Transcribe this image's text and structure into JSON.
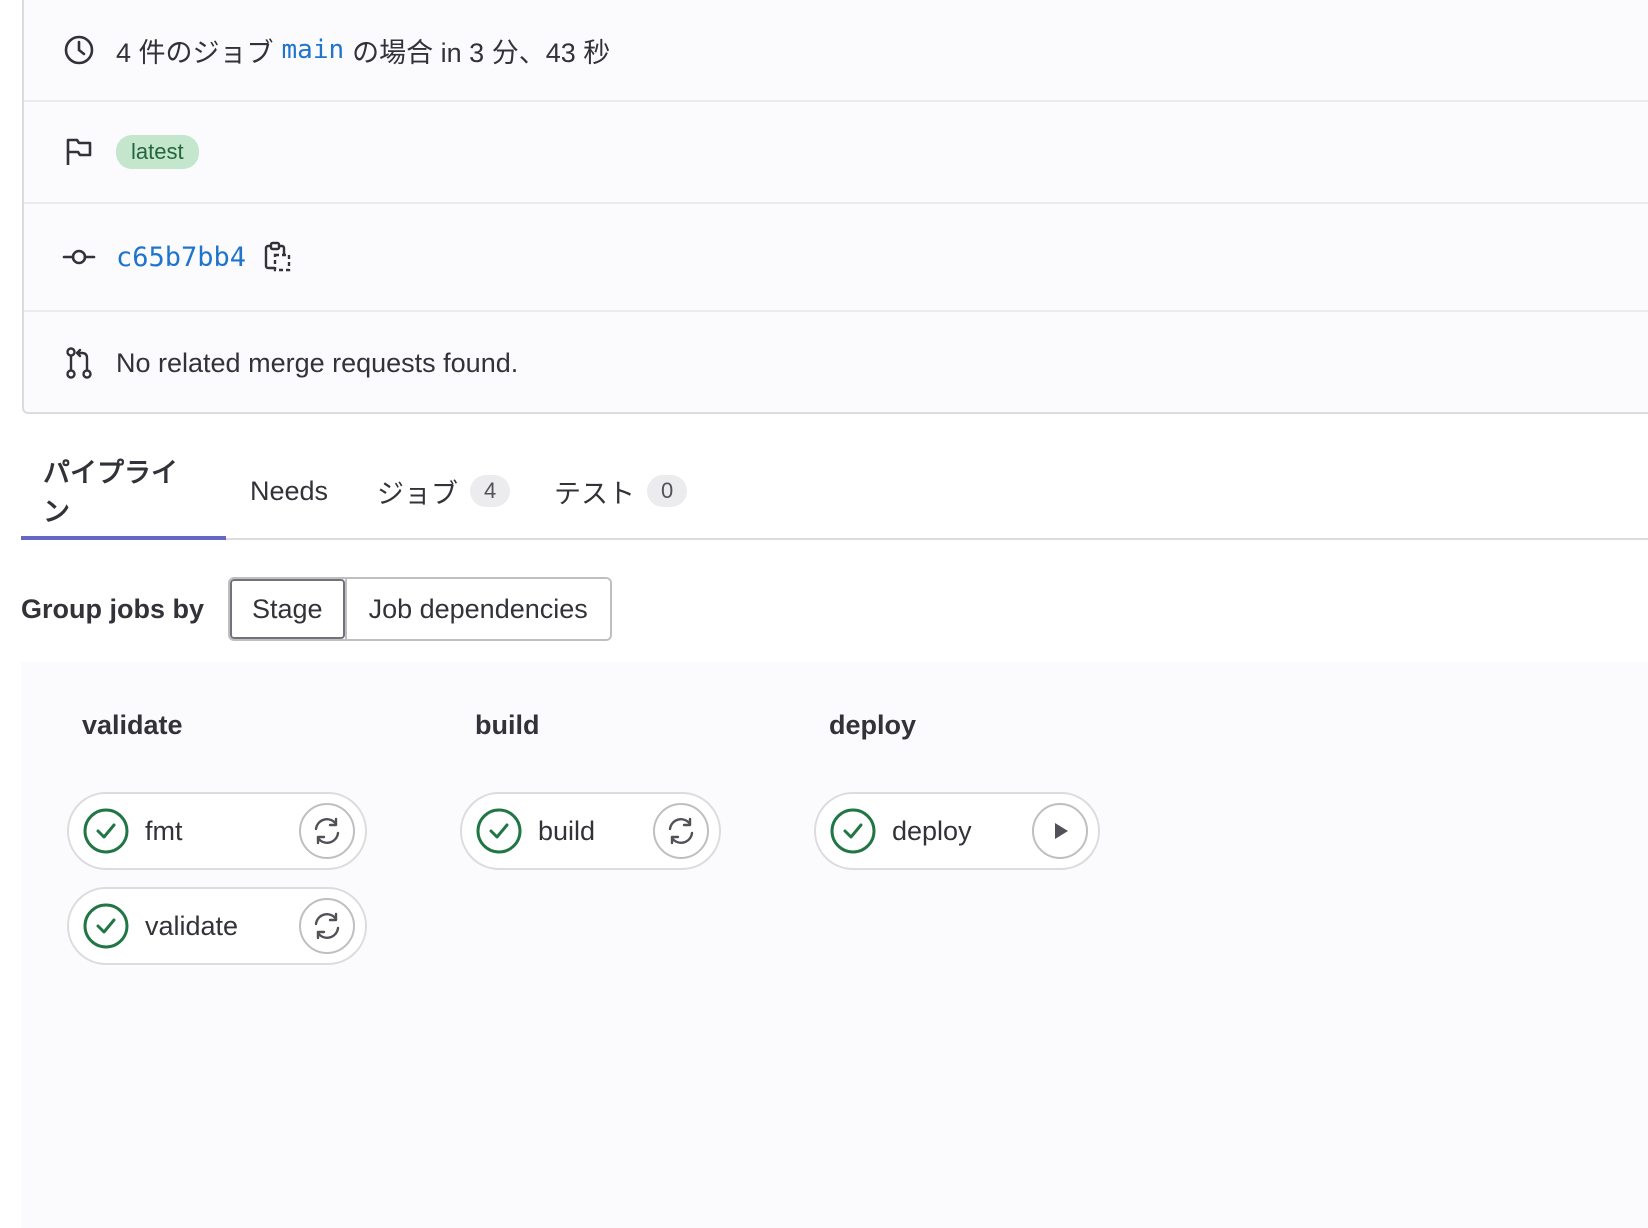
{
  "summary": {
    "jobs_prefix": "4 件のジョブ",
    "ref": "main",
    "jobs_suffix": "の場合 in 3 分、43 秒",
    "badge": "latest",
    "commit_sha": "c65b7bb4",
    "merge_requests": "No related merge requests found."
  },
  "tabs": [
    {
      "label": "パイプライン"
    },
    {
      "label": "Needs"
    },
    {
      "label": "ジョブ",
      "count": "4"
    },
    {
      "label": "テスト",
      "count": "0"
    }
  ],
  "group_by": {
    "label": "Group jobs by",
    "options": [
      "Stage",
      "Job dependencies"
    ],
    "selected": "Stage"
  },
  "stages": [
    {
      "title": "validate",
      "jobs": [
        {
          "name": "fmt",
          "status": "passed",
          "action": "retry-icon"
        },
        {
          "name": "validate",
          "status": "passed",
          "action": "retry-icon"
        }
      ]
    },
    {
      "title": "build",
      "jobs": [
        {
          "name": "build",
          "status": "passed",
          "action": "retry-icon"
        }
      ]
    },
    {
      "title": "deploy",
      "jobs": [
        {
          "name": "deploy",
          "status": "passed",
          "action": "play-icon"
        }
      ]
    }
  ],
  "colors": {
    "link": "#1f75cb",
    "success": "#217645",
    "tab_active": "#6666c4",
    "badge_bg": "#c3e6cd"
  }
}
